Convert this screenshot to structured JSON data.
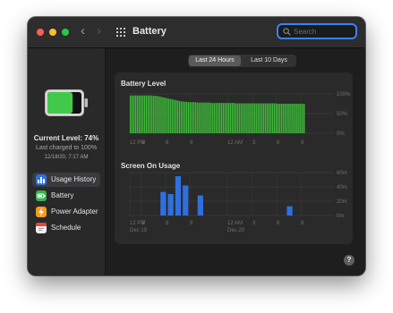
{
  "window": {
    "title": "Battery",
    "traffic_lights": {
      "close": "#ff5f57",
      "minimize": "#febc2e",
      "zoom": "#28c840"
    },
    "nav_back_icon": "chevron-left-icon",
    "nav_forward_icon": "chevron-right-icon",
    "grid_icon": "grid-icon"
  },
  "search": {
    "placeholder": "Search",
    "value": ""
  },
  "sidebar": {
    "battery_level_percent": 74,
    "current_level": "Current Level: 74%",
    "last_charged": "Last charged to 100%",
    "charged_date": "12/18/20, 7:17 AM",
    "items": [
      {
        "label": "Usage History",
        "icon": "bar-chart-icon",
        "color": "#2f6fe0",
        "selected": true
      },
      {
        "label": "Battery",
        "icon": "battery-icon",
        "color": "#34b34a",
        "selected": false
      },
      {
        "label": "Power Adapter",
        "icon": "lightning-icon",
        "color": "#f29b1d",
        "selected": false
      },
      {
        "label": "Schedule",
        "icon": "calendar-icon",
        "color": "#f2f2f2",
        "selected": false
      }
    ]
  },
  "segmented": {
    "options": [
      "Last 24 Hours",
      "Last 10 Days"
    ],
    "selected_index": 0
  },
  "help_label": "?",
  "chart_data": [
    {
      "type": "bar",
      "title": "Battery Level",
      "ylim": [
        0,
        100
      ],
      "y_ticks": [
        "100%",
        "50%",
        "0%"
      ],
      "x_ticks": [
        "12 PM",
        "3",
        "6",
        "9",
        "12 AM",
        "3",
        "6",
        "9"
      ],
      "color": "#3ebd3a",
      "values": [
        96,
        96,
        96,
        96,
        96,
        96,
        96,
        96,
        96,
        96,
        96,
        96,
        96,
        95,
        95,
        95,
        94,
        93,
        92,
        91,
        90,
        89,
        88,
        87,
        86,
        85,
        84,
        83,
        82,
        81,
        81,
        80,
        80,
        79,
        79,
        79,
        79,
        79,
        78,
        78,
        78,
        78,
        78,
        78,
        78,
        78,
        77,
        77,
        77,
        77,
        77,
        77,
        77,
        77,
        77,
        77,
        77,
        77,
        77,
        77,
        76,
        76,
        76,
        76,
        76,
        76,
        76,
        76,
        76,
        76,
        76,
        76,
        76,
        76,
        76,
        76,
        76,
        76,
        76,
        76,
        76,
        76,
        76,
        76,
        75,
        75,
        75,
        75,
        75,
        75,
        75,
        75,
        75,
        75,
        75,
        75,
        75,
        75,
        75,
        74
      ]
    },
    {
      "type": "bar",
      "title": "Screen On Usage",
      "ylim": [
        0,
        60
      ],
      "y_unit": "minutes",
      "y_ticks": [
        "60m",
        "40m",
        "20m",
        "0m"
      ],
      "x_ticks": [
        "12 PM",
        "3",
        "6",
        "9",
        "12 AM",
        "3",
        "6",
        "9"
      ],
      "date_labels": [
        "Dec 19",
        "Dec 20"
      ],
      "color": "#2f6fe0",
      "categories": [
        "12 PM",
        "1 PM",
        "2 PM",
        "3 PM",
        "4 PM",
        "5 PM",
        "6 PM",
        "7 PM",
        "8 PM",
        "9 PM",
        "10 PM",
        "11 PM",
        "12 AM",
        "1 AM",
        "2 AM",
        "3 AM",
        "4 AM",
        "5 AM",
        "6 AM",
        "7 AM",
        "8 AM",
        "9 AM",
        "10 AM",
        "11 AM"
      ],
      "values": [
        0,
        0,
        0,
        0,
        33,
        30,
        55,
        42,
        0,
        28,
        0,
        0,
        0,
        0,
        0,
        0,
        0,
        0,
        0,
        0,
        0,
        13,
        0,
        0
      ]
    }
  ]
}
